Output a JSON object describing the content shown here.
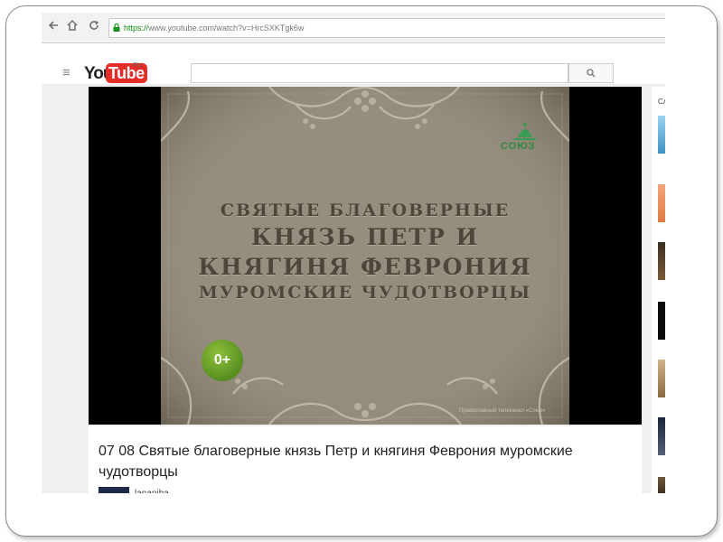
{
  "browser": {
    "url_scheme": "https://",
    "url_rest": "www.youtube.com/watch?v=HrcSXKTgk6w"
  },
  "youtube": {
    "logo_you": "You",
    "logo_tube": "Tube",
    "region": "RU"
  },
  "video": {
    "title_lines": [
      "СВЯТЫЕ БЛАГОВЕРНЫЕ",
      "КНЯЗЬ ПЕТР И",
      "КНЯГИНЯ ФЕВРОНИЯ",
      "МУРОМСКИЕ ЧУДОТВОРЦЫ"
    ],
    "age_rating": "0+",
    "channel_logo_text": "СОЮЗ",
    "watermark": "Православный телеканал «Союз»",
    "heading": "07 08 Святые благоверные князь Петр и княгиня Феврония муромские чудотворцы",
    "uploader": "lananiba"
  },
  "sidebar": {
    "label": "Сл"
  },
  "colors": {
    "youtube_red": "#e52d27",
    "secure_green": "#0b8a0b",
    "video_bg": "#8d8576",
    "title_brown": "#4e463a"
  }
}
